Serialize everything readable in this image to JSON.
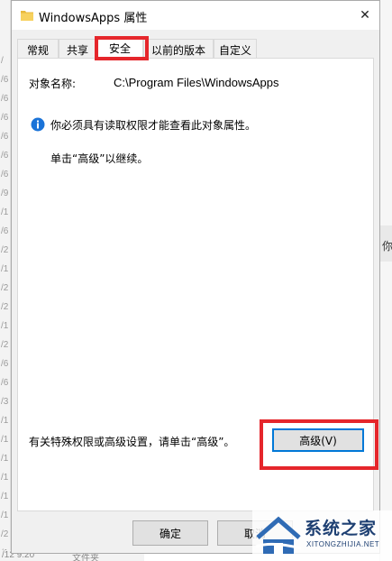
{
  "dialog": {
    "title": "WindowsApps 属性",
    "close_glyph": "✕",
    "tabs": [
      {
        "label": "常规"
      },
      {
        "label": "共享"
      },
      {
        "label": "安全"
      },
      {
        "label": "以前的版本"
      },
      {
        "label": "自定义"
      }
    ],
    "active_tab": "安全",
    "object_label": "对象名称:",
    "object_value": "C:\\Program Files\\WindowsApps",
    "info_text": "你必须具有读取权限才能查看此对象属性。",
    "hint_text": "单击“高级”以继续。",
    "special_text": "有关特殊权限或高级设置，请单击“高级”。",
    "advanced_button": "高级(V)",
    "ok_button": "确定",
    "cancel_button": "取消"
  },
  "background": {
    "left_glyphs": [
      "/",
      "/6",
      "/6",
      "/6",
      "/6",
      "/6",
      "/6",
      "/9",
      "/1",
      "/6",
      "/2",
      "/1",
      "/2",
      "/2",
      "/1",
      "/2",
      "/6",
      "/6",
      "/3",
      "/1",
      "/1",
      "/1",
      "/1",
      "/1",
      "/1",
      "/2",
      "/1"
    ],
    "right_fragment": "你",
    "bottom_left_date": "/12 9:20",
    "bottom_left_type": "文件夹"
  },
  "watermark": {
    "brand": "系统之家",
    "url": "XITONGZHIJIA.NET"
  },
  "colors": {
    "highlight": "#e5262b",
    "accent_blue": "#0078d7",
    "dialog_bg": "#f0f0f0",
    "watermark_text": "#1d3f72"
  }
}
